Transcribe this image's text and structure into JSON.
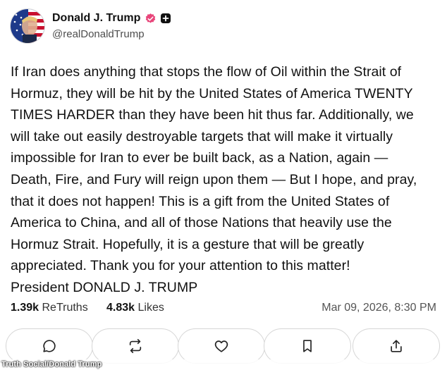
{
  "header": {
    "display_name": "Donald J. Trump",
    "handle": "@realDonaldTrump",
    "verified_color": "#e8457a"
  },
  "post": {
    "text": "If Iran does anything that stops the flow of Oil within the Strait of\nHormuz, they will be hit by the United States of America TWENTY\nTIMES HARDER than they have been hit thus far. Additionally, we\nwill take out easily destroyable targets that will make it virtually\nimpossible for Iran to ever be built back, as a Nation, again —\nDeath, Fire, and Fury will reign upon them — But I hope, and pray,\nthat it does not happen! This is a gift from the United States of\nAmerica to China, and all of those Nations that heavily use the\nHormuz Strait. Hopefully, it is a gesture that will be greatly\nappreciated. Thank you for your attention to this matter!\nPresident DONALD J. TRUMP"
  },
  "stats": {
    "retruths_count": "1.39k",
    "retruths_label": "ReTruths",
    "likes_count": "4.83k",
    "likes_label": "Likes",
    "timestamp": "Mar 09, 2026, 8:30 PM"
  },
  "actions": [
    {
      "icon": "reply-icon"
    },
    {
      "icon": "retruth-icon"
    },
    {
      "icon": "heart-icon"
    },
    {
      "icon": "bookmark-icon"
    },
    {
      "icon": "share-icon"
    }
  ],
  "credit": "Truth Social/Donald Trump"
}
